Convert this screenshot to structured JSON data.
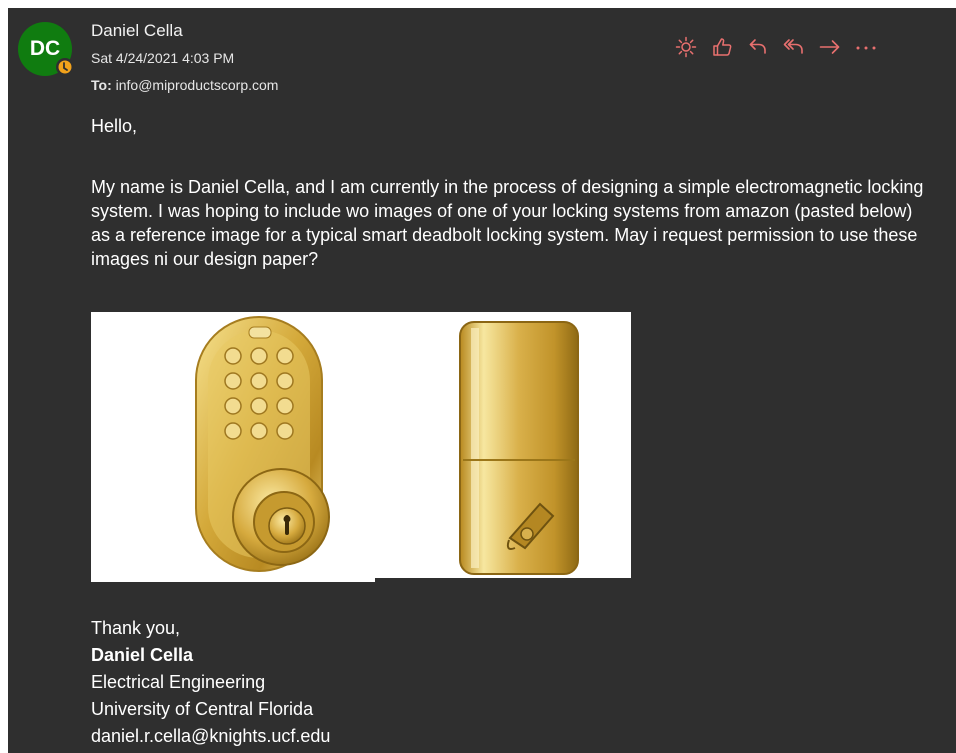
{
  "header": {
    "avatar_initials": "DC",
    "sender_name": "Daniel Cella",
    "date": "Sat 4/24/2021 4:03 PM",
    "to_label": "To:",
    "to_address": "info@miproductscorp.com"
  },
  "actions": [
    {
      "icon": "sun-icon",
      "label": "Brightness"
    },
    {
      "icon": "thumbs-up-icon",
      "label": "Like"
    },
    {
      "icon": "reply-icon",
      "label": "Reply"
    },
    {
      "icon": "reply-all-icon",
      "label": "Reply all"
    },
    {
      "icon": "forward-icon",
      "label": "Forward"
    },
    {
      "icon": "more-icon",
      "label": "More actions"
    }
  ],
  "message": {
    "greeting": "Hello,",
    "paragraph": "My name is Daniel Cella, and I am currently in the process of designing a simple electromagnetic locking system. I was hoping to include wo images of one of your locking systems from amazon (pasted below) as a reference image for a typical smart deadbolt locking system. May i request permission to use these images ni our design paper?",
    "closing": "Thank you,",
    "sig_name": "Daniel Cella",
    "sig_dept": "Electrical Engineering",
    "sig_school": "University of Central Florida",
    "sig_email": "daniel.r.cella@knights.ucf.edu"
  },
  "colors": {
    "background": "#2f2f2f",
    "accent_icons": "#e8706f",
    "avatar": "#107c10",
    "presence": "#f2a21b",
    "brass": "#d4a93a"
  }
}
